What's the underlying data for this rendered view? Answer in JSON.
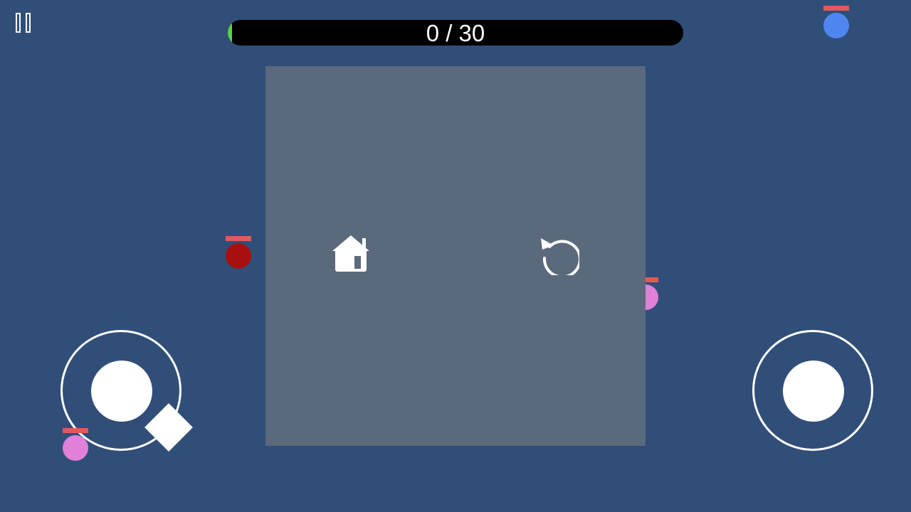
{
  "hud": {
    "pause_icon": "pause-icon",
    "progress": {
      "current": 0,
      "total": 30,
      "label": "0 / 30",
      "fill_fraction": 0.01,
      "fill_color": "#5ad43c",
      "track_color": "#000000"
    }
  },
  "menu": {
    "home_icon": "home-icon",
    "restart_icon": "restart-icon",
    "panel_color": "#5a6a7c"
  },
  "units": [
    {
      "name": "blue-unit",
      "color": "#4f86f0",
      "hp_color": "#e05a5a"
    },
    {
      "name": "red-unit",
      "color": "#a81010",
      "hp_color": "#e05a5a"
    },
    {
      "name": "pink-unit-right",
      "color": "#e080d8",
      "hp_color": "#e05a5a"
    },
    {
      "name": "pink-unit-left",
      "color": "#e080d8",
      "hp_color": "#e05a5a"
    }
  ],
  "controls": {
    "move_joystick_icon": "joystick-icon",
    "aim_joystick_icon": "joystick-icon",
    "player_icon": "diamond-icon"
  },
  "colors": {
    "background": "#304e78",
    "white": "#ffffff"
  }
}
